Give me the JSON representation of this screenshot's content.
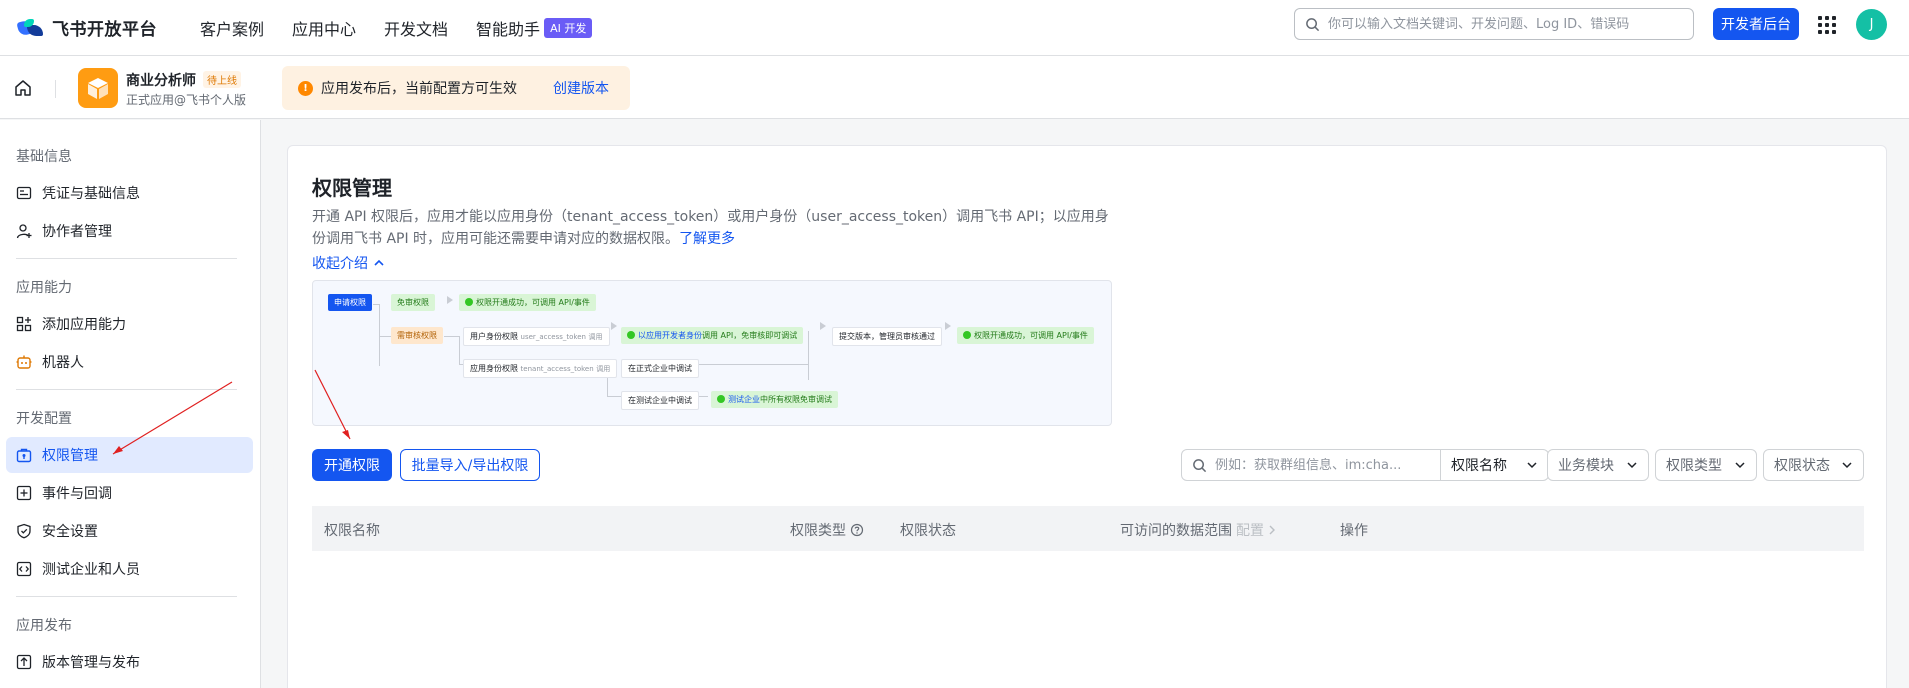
{
  "topnav": {
    "brand": "飞书开放平台",
    "links": [
      "客户案例",
      "应用中心",
      "开发文档",
      "智能助手"
    ],
    "ai_badge": "AI 开发",
    "search_placeholder": "你可以输入文档关键词、开发问题、Log ID、错误码",
    "dev_console": "开发者后台",
    "avatar_initial": "J"
  },
  "appbar": {
    "app_name": "商业分析师",
    "status_tag": "待上线",
    "app_sub": "正式应用@飞书个人版",
    "notice_text": "应用发布后，当前配置方可生效",
    "notice_link": "创建版本"
  },
  "sidebar": {
    "sections": [
      {
        "title": "基础信息",
        "items": [
          {
            "label": "凭证与基础信息",
            "icon": "credential-icon"
          },
          {
            "label": "协作者管理",
            "icon": "user-add-icon"
          }
        ]
      },
      {
        "title": "应用能力",
        "items": [
          {
            "label": "添加应用能力",
            "icon": "apps-add-icon"
          },
          {
            "label": "机器人",
            "icon": "robot-icon"
          }
        ]
      },
      {
        "title": "开发配置",
        "items": [
          {
            "label": "权限管理",
            "icon": "permission-icon",
            "active": true
          },
          {
            "label": "事件与回调",
            "icon": "event-icon"
          },
          {
            "label": "安全设置",
            "icon": "shield-icon"
          },
          {
            "label": "测试企业和人员",
            "icon": "code-icon"
          }
        ]
      },
      {
        "title": "应用发布",
        "items": [
          {
            "label": "版本管理与发布",
            "icon": "upload-icon"
          }
        ]
      }
    ]
  },
  "main": {
    "title": "权限管理",
    "desc_text": "开通 API 权限后，应用才能以应用身份（tenant_access_token）或用户身份（user_access_token）调用飞书 API；以应用身份调用飞书 API 时，应用可能还需要申请对应的数据权限。",
    "learn_more": "了解更多",
    "collapse": "收起介绍",
    "flow": {
      "apply": "申请权限",
      "no_review": "免审权限",
      "ok_call": "权限开通成功，可调用 API/事件",
      "need_review": "需审核权限",
      "user_perm": "用户身份权限",
      "user_token": "user_access_token",
      "call": "调用",
      "dev_call_prefix": "以应用开发者身份",
      "dev_call_suffix": "调用 API，免审核即可调试",
      "submit": "提交版本，管理员审核通过",
      "ok_call2": "权限开通成功，可调用 API/事件",
      "app_perm": "应用身份权限",
      "tenant_token": "tenant_access_token",
      "call2": "调用",
      "prod_debug": "在正式企业中调试",
      "test_debug": "在测试企业中调试",
      "test_free_prefix": "测试企业",
      "test_free_suffix": "中所有权限免审调试"
    },
    "open_btn": "开通权限",
    "batch_btn": "批量导入/导出权限",
    "filter_placeholder": "例如：获取群组信息、im:cha...",
    "filters": [
      "权限名称",
      "业务模块",
      "权限类型",
      "权限状态"
    ],
    "table_headers": [
      "权限名称",
      "权限类型",
      "权限状态",
      "可访问的数据范围",
      "配置",
      "操作"
    ]
  },
  "colors": {
    "accent": "#1456f0",
    "active_bg": "#e1eaff",
    "warn": "#ff8800"
  }
}
